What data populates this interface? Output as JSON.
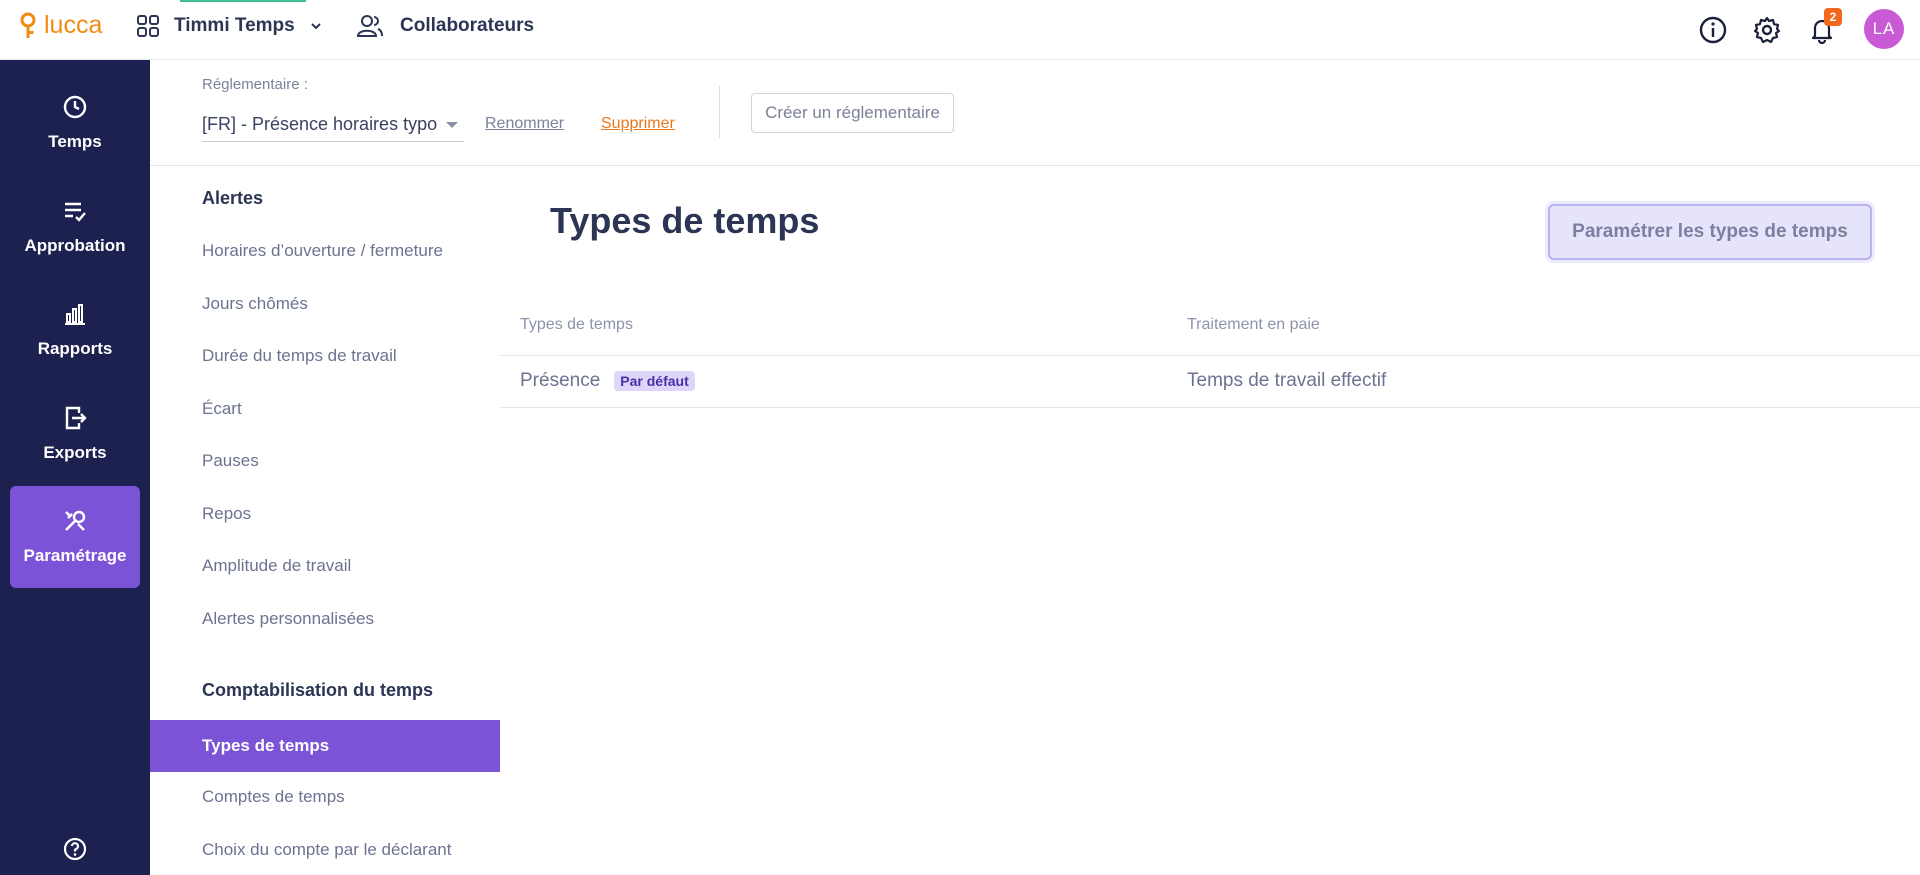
{
  "topbar": {
    "logo_text": "lucca",
    "app_name": "Timmi Temps",
    "collaborators_label": "Collaborateurs",
    "notification_count": "2",
    "avatar_initials": "LA"
  },
  "sidenav": {
    "items": [
      {
        "label": "Temps",
        "icon": "clock-icon"
      },
      {
        "label": "Approbation",
        "icon": "checklist-icon"
      },
      {
        "label": "Rapports",
        "icon": "bar-chart-icon"
      },
      {
        "label": "Exports",
        "icon": "export-icon"
      },
      {
        "label": "Paramétrage",
        "icon": "tools-icon",
        "active": true
      }
    ]
  },
  "regulation": {
    "caption": "Réglementaire :",
    "selected": "[FR] - Présence horaires typo",
    "rename_label": "Renommer",
    "delete_label": "Supprimer",
    "create_label": "Créer un réglementaire"
  },
  "submenu": {
    "alerts_title": "Alertes",
    "alerts_items": [
      "Horaires d’ouverture / fermeture",
      "Jours chômés",
      "Durée du temps de travail",
      "Écart",
      "Pauses",
      "Repos",
      "Amplitude de travail",
      "Alertes personnalisées"
    ],
    "accounting_title": "Comptabilisation du temps",
    "accounting_items": [
      "Types de temps",
      "Comptes de temps",
      "Choix du compte par le déclarant"
    ]
  },
  "main": {
    "title": "Types de temps",
    "configure_button": "Paramétrer les types de temps",
    "table": {
      "headers": [
        "Types de temps",
        "Traitement en paie"
      ],
      "rows": [
        {
          "type": "Présence",
          "badge": "Par défaut",
          "treatment": "Temps de travail effectif"
        }
      ]
    }
  },
  "colors": {
    "nav_bg": "#1d2150",
    "accent": "#7b53d7",
    "brand": "#f28b12",
    "danger_link": "#e8781f"
  }
}
